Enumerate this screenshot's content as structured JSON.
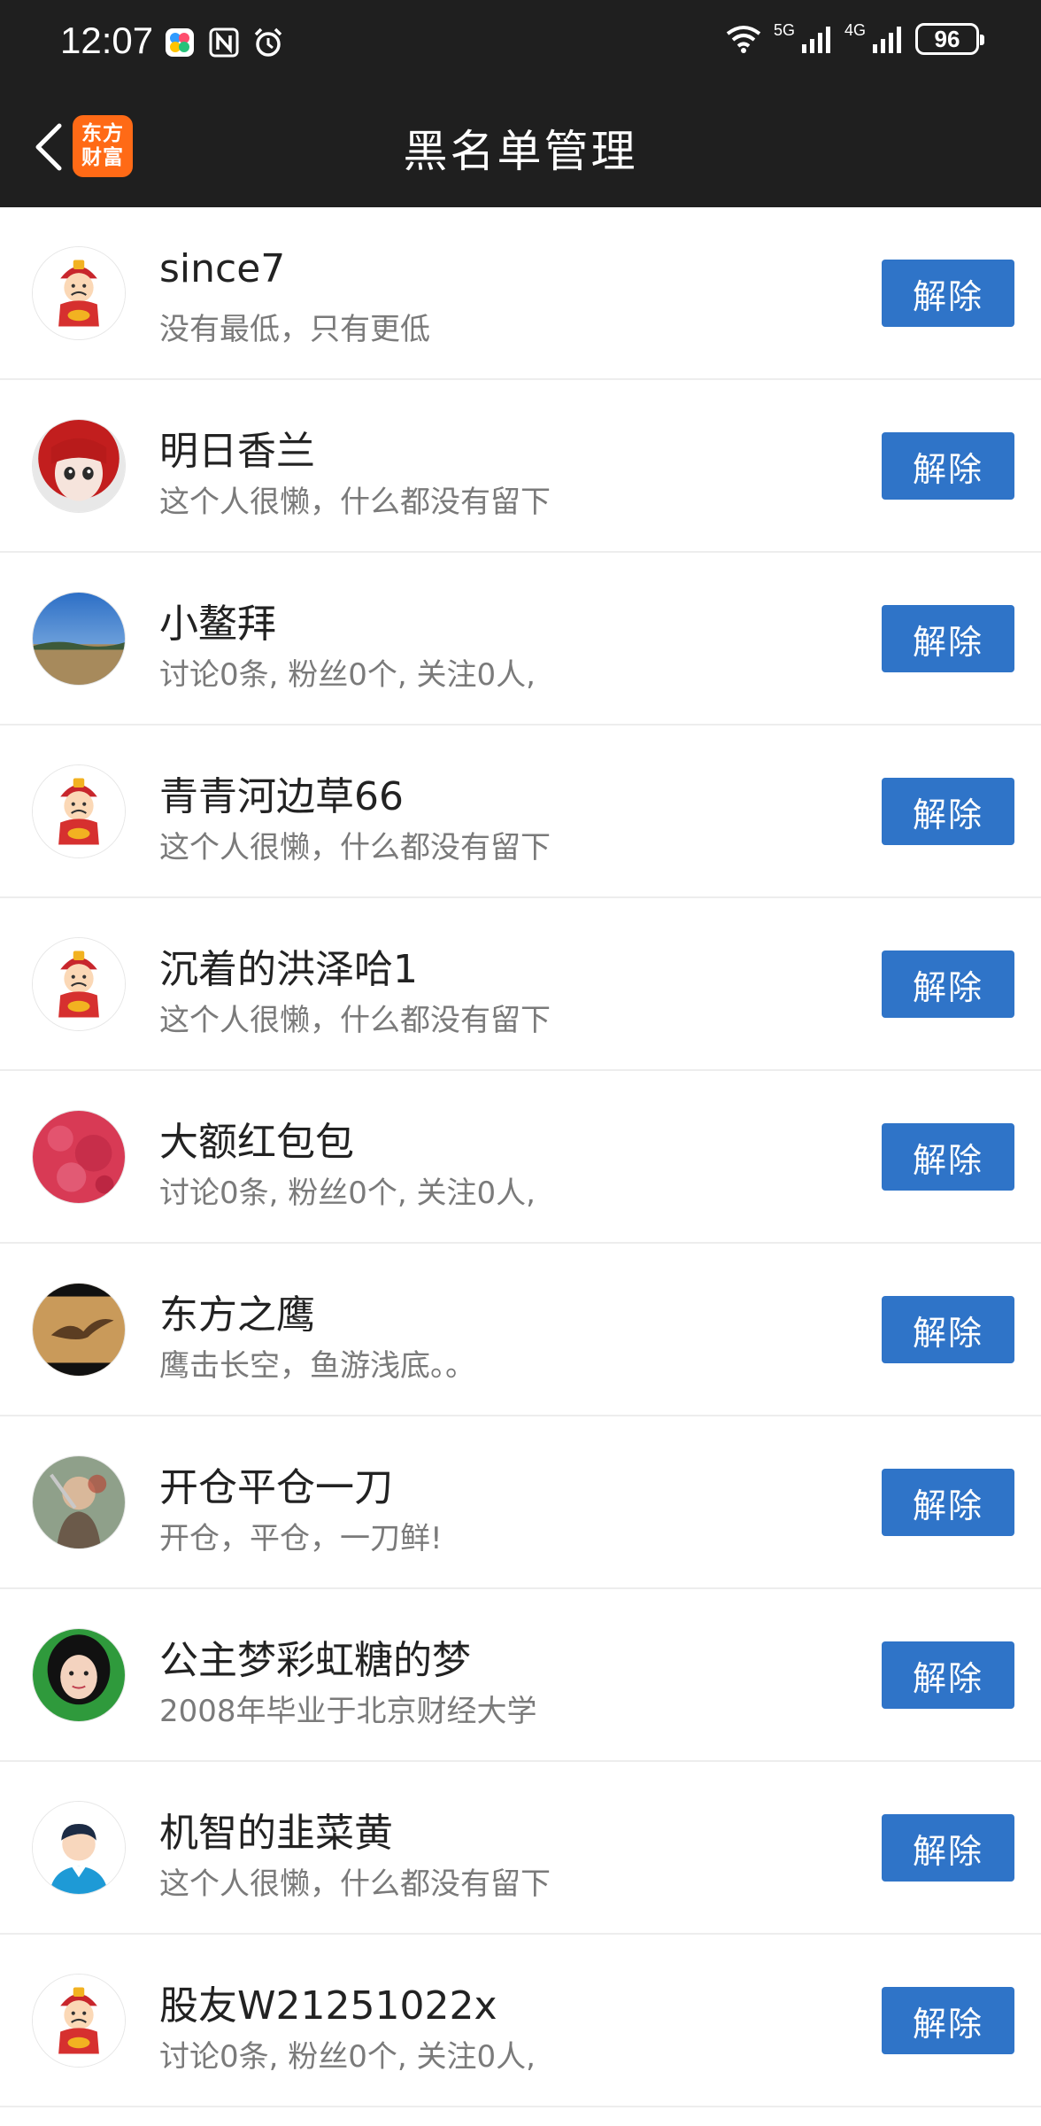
{
  "status_bar": {
    "time": "12:07",
    "network_5g": "5G",
    "network_4g": "4G",
    "battery": "96"
  },
  "header": {
    "title": "黑名单管理",
    "logo_line1": "东方",
    "logo_line2": "财富"
  },
  "blacklist": [
    {
      "name": "since7",
      "bio": "没有最低，只有更低",
      "action": "解除",
      "avatar": "god-of-wealth-avatar"
    },
    {
      "name": "明日香兰",
      "bio": "这个人很懒，什么都没有留下",
      "action": "解除",
      "avatar": "anime-girl-avatar"
    },
    {
      "name": "小鳌拜",
      "bio": "讨论0条, 粉丝0个, 关注0人,",
      "action": "解除",
      "avatar": "landscape-avatar"
    },
    {
      "name": "青青河边草66",
      "bio": "这个人很懒，什么都没有留下",
      "action": "解除",
      "avatar": "god-of-wealth-avatar"
    },
    {
      "name": "沉着的洪泽哈1",
      "bio": "这个人很懒，什么都没有留下",
      "action": "解除",
      "avatar": "god-of-wealth-avatar"
    },
    {
      "name": "大额红包包",
      "bio": "讨论0条, 粉丝0个, 关注0人,",
      "action": "解除",
      "avatar": "red-texture-avatar"
    },
    {
      "name": "东方之鹰",
      "bio": "鹰击长空，鱼游浅底。。",
      "action": "解除",
      "avatar": "eagle-avatar"
    },
    {
      "name": "开仓平仓一刀",
      "bio": "开仓，平仓，一刀鲜!",
      "action": "解除",
      "avatar": "warrior-avatar"
    },
    {
      "name": "公主梦彩虹糖的梦",
      "bio": "2008年毕业于北京财经大学",
      "action": "解除",
      "avatar": "girl-photo-avatar"
    },
    {
      "name": "机智的韭菜黄",
      "bio": "这个人很懒，什么都没有留下",
      "action": "解除",
      "avatar": "cartoon-man-avatar"
    },
    {
      "name": "股友W21251022x",
      "bio": "讨论0条, 粉丝0个, 关注0人,",
      "action": "解除",
      "avatar": "god-of-wealth-avatar"
    }
  ]
}
